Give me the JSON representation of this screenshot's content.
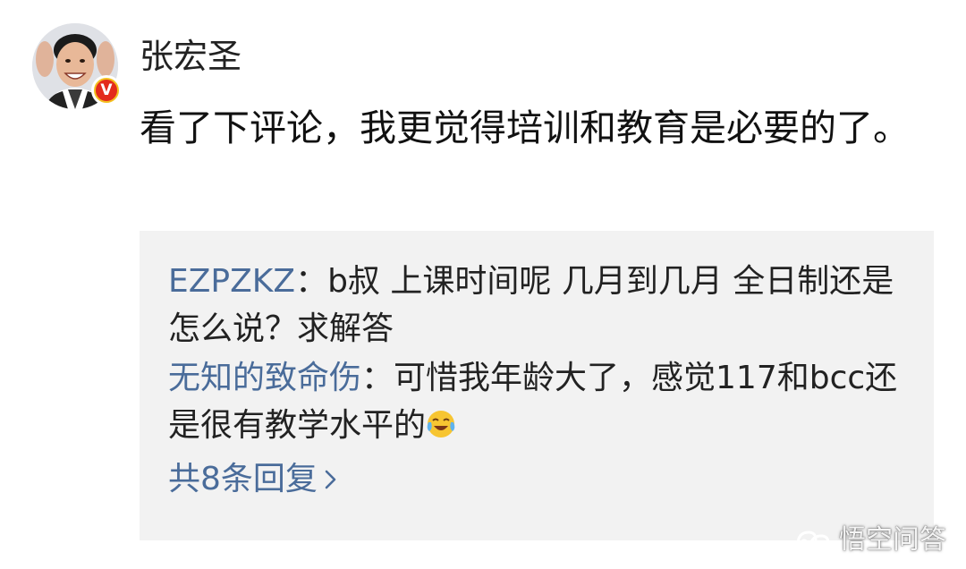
{
  "comment": {
    "author": "张宏圣",
    "text": "看了下评论，我更觉得培训和教育是必要的了。",
    "verified_badge": "V"
  },
  "replies": [
    {
      "author": "EZPZKZ",
      "separator": "：",
      "text": "b叔 上课时间呢 几月到几月 全日制还是怎么说？求解答"
    },
    {
      "author": "无知的致命伤",
      "separator": "：",
      "text": "可惜我年龄大了，感觉117和bcc还是很有教学水平的",
      "emoji": "laugh-cry-emoji"
    }
  ],
  "more_replies_label": "共8条回复",
  "watermark": "悟空问答",
  "colors": {
    "link_blue": "#4a6c9a",
    "panel_bg": "#f2f2f2",
    "badge_red": "#e32b1c",
    "badge_ring": "#f4c020"
  }
}
